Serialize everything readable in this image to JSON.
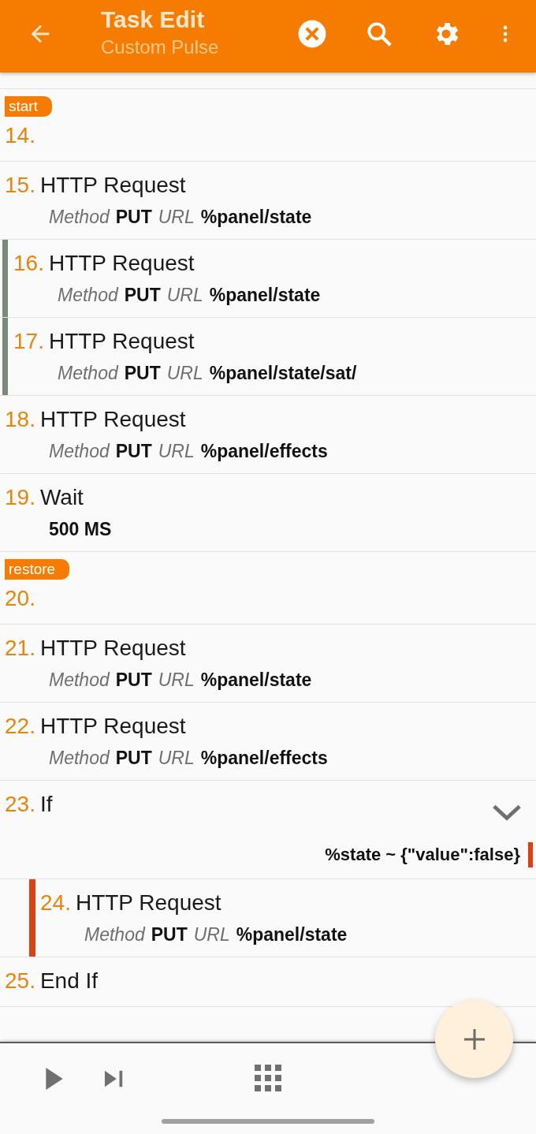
{
  "toolbar": {
    "title": "Task Edit",
    "subtitle": "Custom Pulse"
  },
  "actions": [
    {
      "number": "14.",
      "label": "start",
      "selected": false
    },
    {
      "number": "15.",
      "name": "HTTP Request",
      "selected": false,
      "params": [
        {
          "kind": "label",
          "text": "Method"
        },
        {
          "kind": "value",
          "text": "PUT"
        },
        {
          "kind": "label",
          "text": "URL"
        },
        {
          "kind": "value",
          "text": "%panel/state"
        }
      ]
    },
    {
      "number": "16.",
      "name": "HTTP Request",
      "selected": true,
      "params": [
        {
          "kind": "label",
          "text": "Method"
        },
        {
          "kind": "value",
          "text": "PUT"
        },
        {
          "kind": "label",
          "text": "URL"
        },
        {
          "kind": "value",
          "text": "%panel/state"
        }
      ]
    },
    {
      "number": "17.",
      "name": "HTTP Request",
      "selected": true,
      "params": [
        {
          "kind": "label",
          "text": "Method"
        },
        {
          "kind": "value",
          "text": "PUT"
        },
        {
          "kind": "label",
          "text": "URL"
        },
        {
          "kind": "value",
          "text": "%panel/state/sat/"
        }
      ]
    },
    {
      "number": "18.",
      "name": "HTTP Request",
      "selected": false,
      "params": [
        {
          "kind": "label",
          "text": "Method"
        },
        {
          "kind": "value",
          "text": "PUT"
        },
        {
          "kind": "label",
          "text": "URL"
        },
        {
          "kind": "value",
          "text": "%panel/effects"
        }
      ]
    },
    {
      "number": "19.",
      "name": "Wait",
      "selected": false,
      "params": [
        {
          "kind": "value",
          "text": "500 MS"
        }
      ]
    },
    {
      "number": "20.",
      "label": "restore",
      "selected": false
    },
    {
      "number": "21.",
      "name": "HTTP Request",
      "selected": false,
      "params": [
        {
          "kind": "label",
          "text": "Method"
        },
        {
          "kind": "value",
          "text": "PUT"
        },
        {
          "kind": "label",
          "text": "URL"
        },
        {
          "kind": "value",
          "text": "%panel/state"
        }
      ]
    },
    {
      "number": "22.",
      "name": "HTTP Request",
      "selected": false,
      "params": [
        {
          "kind": "label",
          "text": "Method"
        },
        {
          "kind": "value",
          "text": "PUT"
        },
        {
          "kind": "label",
          "text": "URL"
        },
        {
          "kind": "value",
          "text": "%panel/effects"
        }
      ]
    },
    {
      "number": "23.",
      "name": "If",
      "selected": false,
      "expanded": true,
      "color": "#d84315",
      "condition": "%state ~ {\"value\":false}",
      "children": [
        {
          "number": "24.",
          "name": "HTTP Request",
          "selected": false,
          "params": [
            {
              "kind": "label",
              "text": "Method"
            },
            {
              "kind": "value",
              "text": "PUT"
            },
            {
              "kind": "label",
              "text": "URL"
            },
            {
              "kind": "value",
              "text": "%panel/state"
            }
          ]
        }
      ]
    },
    {
      "number": "25.",
      "name": "End If",
      "selected": false
    }
  ]
}
